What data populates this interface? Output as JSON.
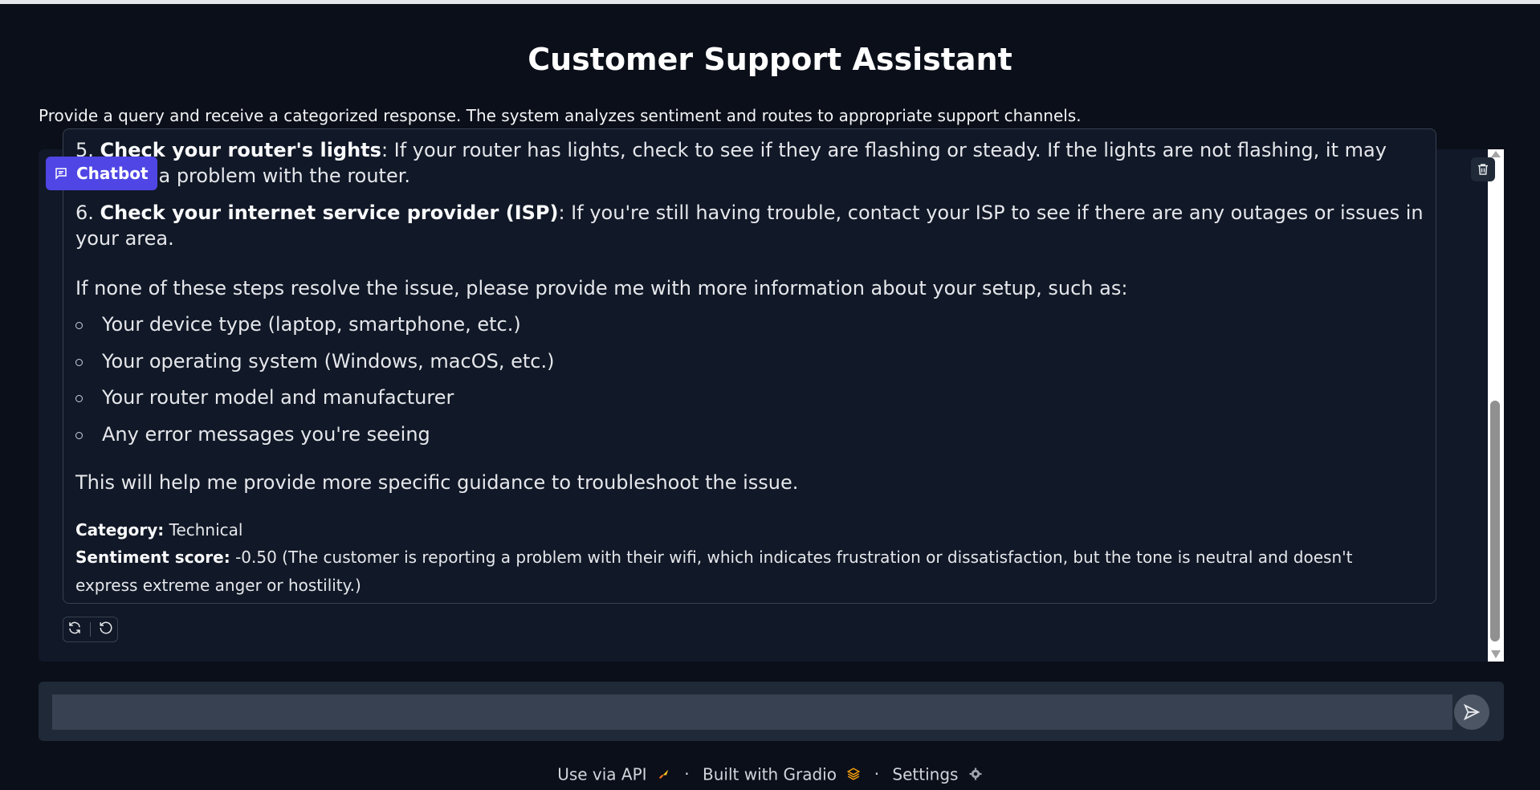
{
  "app": {
    "title": "Customer Support Assistant",
    "description": "Provide a query and receive a categorized response. The system analyzes sentiment and routes to appropriate support channels."
  },
  "chatbot": {
    "label": "Chatbot",
    "message": {
      "partial_line_a_num": "5.",
      "partial_line_a_bold": "Check your router's lights",
      "partial_line_a_rest": ": If your router has lights, check to see if they are flashing or steady. If the lights are not flashing, it may",
      "partial_line_b": "indicate a problem with the router.",
      "step6_num": "6.",
      "step6_bold": "Check your internet service provider (ISP)",
      "step6_rest": ": If you're still having trouble, contact your ISP to see if there are any outages or issues in",
      "step6_cont": "your area.",
      "intro": "If none of these steps resolve the issue, please provide me with more information about your setup, such as:",
      "bullets": [
        "Your device type (laptop, smartphone, etc.)",
        "Your operating system (Windows, macOS, etc.)",
        "Your router model and manufacturer",
        "Any error messages you're seeing"
      ],
      "closing": "This will help me provide more specific guidance to troubleshoot the issue.",
      "category_label": "Category:",
      "category_value": "Technical",
      "sentiment_label": "Sentiment score:",
      "sentiment_value": "-0.50 (The customer is reporting a problem with their wifi, which indicates frustration or dissatisfaction, but the tone is neutral and doesn't",
      "sentiment_cont": "express extreme anger or hostility.)"
    }
  },
  "input": {
    "value": "",
    "placeholder": ""
  },
  "footer": {
    "api": "Use via API",
    "gradio": "Built with Gradio",
    "settings": "Settings",
    "separator": "·"
  },
  "icons": {
    "chat": "chat-bubble-icon",
    "trash": "trash-icon",
    "retry": "retry-icon",
    "undo": "undo-icon",
    "send": "send-icon",
    "rocket": "rocket-icon",
    "gradio_logo": "gradio-logo-icon",
    "settings": "gear-icon"
  },
  "colors": {
    "background": "#0b0f19",
    "panel": "#111827",
    "accent": "#4f46e5",
    "input": "#374151"
  }
}
